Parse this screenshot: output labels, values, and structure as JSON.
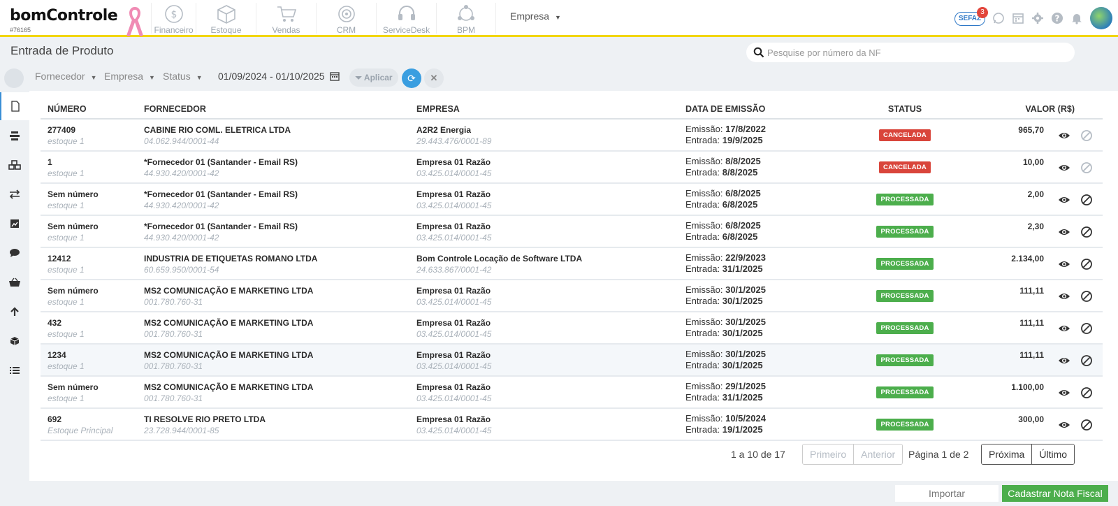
{
  "app": {
    "logo_text": "bomControle",
    "account_id": "#76165"
  },
  "nav": [
    {
      "label": "Financeiro",
      "icon": "dollar-circle-icon"
    },
    {
      "label": "Estoque",
      "icon": "box-icon"
    },
    {
      "label": "Vendas",
      "icon": "cart-icon"
    },
    {
      "label": "CRM",
      "icon": "target-icon"
    },
    {
      "label": "ServiceDesk",
      "icon": "headset-icon"
    },
    {
      "label": "BPM",
      "icon": "network-icon"
    }
  ],
  "empresa_dropdown": "Empresa",
  "sefaz": {
    "label": "SEFAZ",
    "badge": "3"
  },
  "page_title": "Entrada de Produto",
  "search": {
    "placeholder": "Pesquise por número da NF"
  },
  "filters": {
    "fornecedor": "Fornecedor",
    "empresa": "Empresa",
    "status": "Status",
    "date_range": "01/09/2024 - 01/10/2025",
    "apply_label": "Aplicar"
  },
  "table": {
    "headers": {
      "numero": "NÚMERO",
      "fornecedor": "FORNECEDOR",
      "empresa": "EMPRESA",
      "data": "DATA DE EMISSÃO",
      "status": "STATUS",
      "valor": "VALOR (R$)"
    },
    "emissao_label": "Emissão:",
    "entrada_label": "Entrada:",
    "rows": [
      {
        "numero": "277409",
        "estoque": "estoque 1",
        "fornecedor": "CABINE RIO COML. ELETRICA LTDA",
        "forn_doc": "04.062.944/0001-44",
        "empresa": "A2R2 Energia",
        "emp_doc": "29.443.476/0001-89",
        "emissao": "17/8/2022",
        "entrada": "19/9/2025",
        "status": "CANCELADA",
        "status_color": "#d9453b",
        "valor": "965,70"
      },
      {
        "numero": "1",
        "estoque": "estoque 1",
        "fornecedor": "*Fornecedor 01 (Santander - Email RS)",
        "forn_doc": "44.930.420/0001-42",
        "empresa": "Empresa 01 Razão",
        "emp_doc": "03.425.014/0001-45",
        "emissao": "8/8/2025",
        "entrada": "8/8/2025",
        "status": "CANCELADA",
        "status_color": "#d9453b",
        "valor": "10,00"
      },
      {
        "numero": "Sem número",
        "estoque": "estoque 1",
        "fornecedor": "*Fornecedor 01 (Santander - Email RS)",
        "forn_doc": "44.930.420/0001-42",
        "empresa": "Empresa 01 Razão",
        "emp_doc": "03.425.014/0001-45",
        "emissao": "6/8/2025",
        "entrada": "6/8/2025",
        "status": "PROCESSADA",
        "status_color": "#4cae4c",
        "valor": "2,00"
      },
      {
        "numero": "Sem número",
        "estoque": "estoque 1",
        "fornecedor": "*Fornecedor 01 (Santander - Email RS)",
        "forn_doc": "44.930.420/0001-42",
        "empresa": "Empresa 01 Razão",
        "emp_doc": "03.425.014/0001-45",
        "emissao": "6/8/2025",
        "entrada": "6/8/2025",
        "status": "PROCESSADA",
        "status_color": "#4cae4c",
        "valor": "2,30"
      },
      {
        "numero": "12412",
        "estoque": "estoque 1",
        "fornecedor": "INDUSTRIA DE ETIQUETAS ROMANO LTDA",
        "forn_doc": "60.659.950/0001-54",
        "empresa": "Bom Controle Locação de Software LTDA",
        "emp_doc": "24.633.867/0001-42",
        "emissao": "22/9/2023",
        "entrada": "31/1/2025",
        "status": "PROCESSADA",
        "status_color": "#4cae4c",
        "valor": "2.134,00"
      },
      {
        "numero": "Sem número",
        "estoque": "estoque 1",
        "fornecedor": "MS2 COMUNICAÇÃO E MARKETING LTDA",
        "forn_doc": "001.780.760-31",
        "empresa": "Empresa 01 Razão",
        "emp_doc": "03.425.014/0001-45",
        "emissao": "30/1/2025",
        "entrada": "30/1/2025",
        "status": "PROCESSADA",
        "status_color": "#4cae4c",
        "valor": "111,11"
      },
      {
        "numero": "432",
        "estoque": "estoque 1",
        "fornecedor": "MS2 COMUNICAÇÃO E MARKETING LTDA",
        "forn_doc": "001.780.760-31",
        "empresa": "Empresa 01 Razão",
        "emp_doc": "03.425.014/0001-45",
        "emissao": "30/1/2025",
        "entrada": "30/1/2025",
        "status": "PROCESSADA",
        "status_color": "#4cae4c",
        "valor": "111,11"
      },
      {
        "numero": "1234",
        "estoque": "estoque 1",
        "fornecedor": "MS2 COMUNICAÇÃO E MARKETING LTDA",
        "forn_doc": "001.780.760-31",
        "empresa": "Empresa 01 Razão",
        "emp_doc": "03.425.014/0001-45",
        "emissao": "30/1/2025",
        "entrada": "30/1/2025",
        "status": "PROCESSADA",
        "status_color": "#4cae4c",
        "valor": "111,11"
      },
      {
        "numero": "Sem número",
        "estoque": "estoque 1",
        "fornecedor": "MS2 COMUNICAÇÃO E MARKETING LTDA",
        "forn_doc": "001.780.760-31",
        "empresa": "Empresa 01 Razão",
        "emp_doc": "03.425.014/0001-45",
        "emissao": "29/1/2025",
        "entrada": "31/1/2025",
        "status": "PROCESSADA",
        "status_color": "#4cae4c",
        "valor": "1.100,00"
      },
      {
        "numero": "692",
        "estoque": "Estoque Principal",
        "fornecedor": "TI RESOLVE RIO PRETO LTDA",
        "forn_doc": "23.728.944/0001-85",
        "empresa": "Empresa 01 Razão",
        "emp_doc": "03.425.014/0001-45",
        "emissao": "10/5/2024",
        "entrada": "19/1/2025",
        "status": "PROCESSADA",
        "status_color": "#4cae4c",
        "valor": "300,00"
      }
    ]
  },
  "pagination": {
    "info": "1 a 10 de 17",
    "first": "Primeiro",
    "prev": "Anterior",
    "page": "Página 1 de 2",
    "next": "Próxima",
    "last": "Último"
  },
  "footer": {
    "import_label": "Importar",
    "create_label": "Cadastrar Nota Fiscal"
  },
  "colors": {
    "accent_yellow": "#f2d600",
    "accent_blue": "#3a9ee0",
    "status_green": "#4cae4c",
    "status_red": "#d9453b"
  }
}
